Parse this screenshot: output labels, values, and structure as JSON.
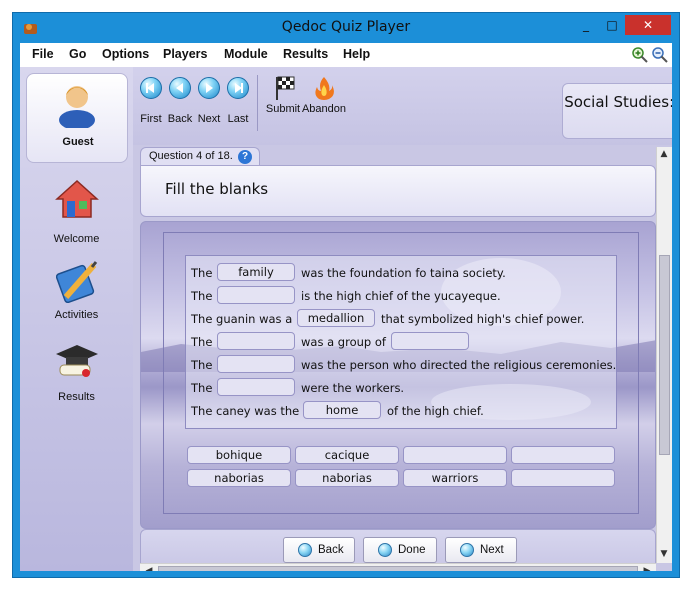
{
  "window": {
    "title": "Qedoc Quiz Player",
    "controls": [
      "_",
      "□",
      "✕"
    ],
    "close_color": "#c9312c"
  },
  "menu": {
    "items": [
      "File",
      "Go",
      "Options",
      "Players",
      "Module",
      "Results",
      "Help"
    ]
  },
  "toolbar": {
    "nav": [
      "First",
      "Back",
      "Next",
      "Last"
    ],
    "submit": "Submit",
    "abandon": "Abandon",
    "module_title": "Social Studies: Taino society"
  },
  "sidebar": {
    "user": "Guest",
    "items": [
      {
        "label": "Welcome",
        "icon": "house-icon"
      },
      {
        "label": "Activities",
        "icon": "pencil-book-icon"
      },
      {
        "label": "Results",
        "icon": "graduation-cap-icon"
      }
    ]
  },
  "question": {
    "counter": "Question 4 of 18.",
    "help": "?",
    "heading": "Fill the blanks",
    "rows": [
      {
        "pre": "The",
        "slot1": "family",
        "mid": "was the foundation fo taina society."
      },
      {
        "pre": "The",
        "slot1": "",
        "mid": "is the high chief of the yucayeque."
      },
      {
        "pre": "The guanin was a",
        "slot1": "medallion",
        "mid": "that symbolized high's chief power."
      },
      {
        "pre": "The",
        "slot1": "",
        "mid": "was a group of",
        "slot2": ""
      },
      {
        "pre": "The",
        "slot1": "",
        "mid": "was the person who directed the religious ceremonies."
      },
      {
        "pre": "The",
        "slot1": "",
        "mid": "were the workers."
      },
      {
        "pre": "The caney was the",
        "slot1": "home",
        "mid": "of the high chief."
      }
    ],
    "word_bank": [
      "bohique",
      "cacique",
      "",
      "",
      "naborias",
      "naborias",
      "warriors",
      ""
    ]
  },
  "footer": {
    "back": "Back",
    "done": "Done",
    "next": "Next"
  },
  "colors": {
    "frame_blue": "#1c8fd8",
    "panel_lavender": "#c9c7e4"
  }
}
